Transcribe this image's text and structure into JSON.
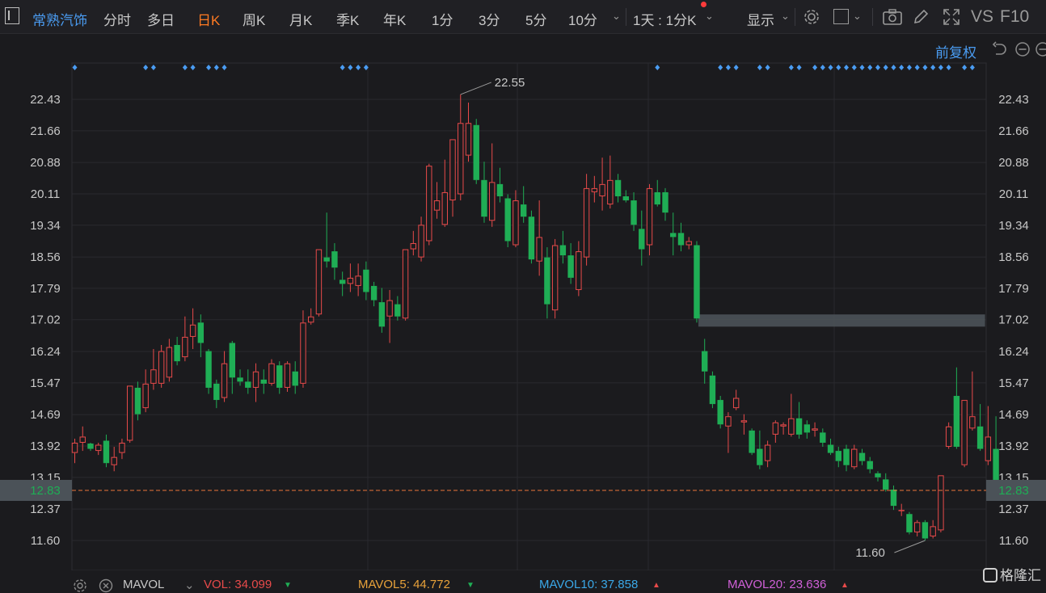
{
  "toolbar": {
    "menu_icon": "menu-icon",
    "stock_name": "常熟汽饰",
    "periods": [
      "分时",
      "多日",
      "日K",
      "周K",
      "月K",
      "季K",
      "年K",
      "1分",
      "3分",
      "5分",
      "10分"
    ],
    "active_period": "日K",
    "interval_select": "1天 : 1分K",
    "display_label": "显示",
    "vs_label": "VS",
    "f10_label": "F10"
  },
  "subbar": {
    "adjust_label": "前复权"
  },
  "colors": {
    "up": "#e84a4a",
    "down": "#1fae55",
    "accent": "#4a9cf2",
    "active": "#ff7a22",
    "last_price_line": "#e8743a"
  },
  "chart_data": {
    "type": "candlestick",
    "y_ticks": [
      22.43,
      21.66,
      20.88,
      20.11,
      19.34,
      18.56,
      17.79,
      17.02,
      16.24,
      15.47,
      14.69,
      13.92,
      13.15,
      12.37,
      11.6
    ],
    "ylim": [
      11.2,
      23.2
    ],
    "last_price": 12.83,
    "high_label": "22.55",
    "low_label": "11.60",
    "grid": true,
    "candles": [
      [
        13.75,
        14.0,
        14.1,
        13.5
      ],
      [
        14.0,
        14.15,
        14.4,
        13.8
      ],
      [
        13.98,
        13.85,
        14.0,
        13.8
      ],
      [
        13.8,
        13.95,
        14.0,
        13.7
      ],
      [
        14.05,
        13.5,
        14.2,
        13.4
      ],
      [
        13.45,
        13.65,
        13.9,
        13.3
      ],
      [
        13.75,
        14.0,
        14.1,
        13.6
      ],
      [
        14.05,
        15.4,
        15.4,
        14.0
      ],
      [
        15.35,
        14.7,
        15.5,
        14.55
      ],
      [
        14.85,
        15.45,
        15.8,
        14.75
      ],
      [
        15.45,
        15.8,
        16.3,
        15.3
      ],
      [
        15.45,
        16.25,
        16.4,
        15.35
      ],
      [
        15.6,
        16.35,
        16.55,
        15.5
      ],
      [
        16.4,
        16.0,
        16.6,
        15.9
      ],
      [
        16.1,
        16.6,
        17.1,
        16.0
      ],
      [
        16.6,
        16.9,
        17.3,
        16.3
      ],
      [
        16.95,
        16.45,
        17.15,
        16.1
      ],
      [
        16.25,
        15.35,
        16.3,
        15.2
      ],
      [
        15.45,
        15.05,
        15.55,
        14.85
      ],
      [
        15.1,
        15.95,
        16.25,
        15.0
      ],
      [
        16.45,
        15.6,
        16.5,
        15.2
      ],
      [
        15.6,
        15.5,
        15.8,
        15.4
      ],
      [
        15.5,
        15.35,
        15.8,
        15.2
      ],
      [
        15.35,
        15.75,
        15.95,
        15.0
      ],
      [
        15.55,
        15.45,
        15.8,
        15.2
      ],
      [
        15.45,
        15.95,
        16.05,
        15.4
      ],
      [
        15.9,
        15.35,
        16.0,
        15.2
      ],
      [
        15.35,
        15.95,
        16.0,
        15.25
      ],
      [
        15.75,
        15.4,
        16.0,
        15.2
      ],
      [
        15.45,
        16.95,
        17.25,
        15.35
      ],
      [
        16.95,
        17.1,
        17.3,
        16.9
      ],
      [
        17.15,
        18.75,
        18.75,
        17.1
      ],
      [
        18.55,
        18.45,
        19.65,
        18.3
      ],
      [
        18.7,
        18.3,
        18.9,
        18.0
      ],
      [
        18.0,
        17.9,
        18.2,
        17.6
      ],
      [
        17.9,
        18.05,
        18.4,
        17.7
      ],
      [
        17.85,
        18.1,
        18.4,
        17.6
      ],
      [
        18.25,
        17.7,
        18.45,
        17.5
      ],
      [
        17.85,
        17.5,
        17.95,
        17.35
      ],
      [
        17.45,
        16.85,
        17.8,
        16.7
      ],
      [
        17.1,
        17.5,
        17.75,
        16.45
      ],
      [
        17.4,
        17.1,
        17.6,
        17.0
      ],
      [
        17.05,
        18.75,
        18.75,
        17.0
      ],
      [
        18.75,
        18.9,
        19.2,
        18.6
      ],
      [
        18.55,
        19.35,
        19.55,
        18.45
      ],
      [
        18.95,
        20.8,
        20.85,
        18.85
      ],
      [
        19.7,
        19.95,
        20.4,
        19.5
      ],
      [
        19.35,
        20.15,
        20.95,
        19.3
      ],
      [
        19.95,
        21.45,
        21.45,
        19.55
      ],
      [
        20.1,
        21.85,
        22.55,
        19.95
      ],
      [
        21.05,
        21.85,
        22.35,
        20.9
      ],
      [
        21.8,
        20.45,
        21.95,
        20.35
      ],
      [
        20.45,
        19.55,
        20.9,
        19.4
      ],
      [
        19.45,
        20.4,
        21.35,
        19.3
      ],
      [
        20.35,
        20.05,
        20.75,
        19.9
      ],
      [
        20.0,
        18.95,
        20.1,
        18.8
      ],
      [
        18.85,
        19.95,
        20.2,
        18.8
      ],
      [
        19.85,
        19.55,
        20.3,
        19.4
      ],
      [
        19.55,
        18.5,
        19.7,
        18.4
      ],
      [
        18.45,
        19.05,
        19.95,
        18.1
      ],
      [
        18.55,
        17.4,
        18.8,
        17.05
      ],
      [
        17.25,
        18.85,
        19.0,
        17.05
      ],
      [
        18.85,
        18.6,
        19.2,
        18.4
      ],
      [
        18.6,
        18.05,
        18.9,
        17.9
      ],
      [
        17.75,
        18.7,
        18.95,
        17.6
      ],
      [
        18.55,
        20.25,
        20.6,
        18.35
      ],
      [
        20.15,
        20.25,
        20.55,
        19.9
      ],
      [
        20.05,
        20.35,
        21.0,
        19.7
      ],
      [
        19.85,
        20.45,
        21.05,
        19.75
      ],
      [
        20.45,
        20.05,
        20.6,
        19.9
      ],
      [
        20.05,
        19.95,
        20.2,
        19.9
      ],
      [
        19.95,
        19.35,
        20.15,
        19.2
      ],
      [
        19.25,
        18.75,
        19.7,
        18.35
      ],
      [
        18.85,
        20.25,
        20.35,
        18.6
      ],
      [
        20.15,
        19.85,
        20.45,
        19.8
      ],
      [
        20.15,
        19.65,
        20.25,
        19.45
      ],
      [
        19.15,
        19.05,
        19.65,
        18.6
      ],
      [
        19.15,
        18.85,
        19.4,
        18.7
      ],
      [
        18.85,
        18.95,
        19.05,
        18.75
      ],
      [
        18.85,
        17.05,
        18.95,
        16.95
      ],
      [
        16.25,
        15.75,
        16.55,
        15.45
      ],
      [
        15.65,
        14.95,
        15.75,
        14.85
      ],
      [
        15.05,
        14.45,
        15.15,
        14.35
      ],
      [
        14.4,
        14.65,
        14.75,
        13.75
      ],
      [
        14.85,
        15.1,
        15.3,
        14.8
      ],
      [
        14.5,
        14.55,
        14.7,
        14.2
      ],
      [
        14.3,
        13.75,
        14.35,
        13.7
      ],
      [
        13.85,
        13.45,
        14.3,
        13.35
      ],
      [
        13.55,
        13.95,
        14.05,
        13.4
      ],
      [
        14.2,
        14.5,
        14.55,
        14.0
      ],
      [
        14.4,
        14.45,
        14.5,
        14.2
      ],
      [
        14.2,
        14.6,
        15.2,
        14.15
      ],
      [
        14.6,
        14.2,
        15.0,
        14.1
      ],
      [
        14.45,
        14.25,
        14.55,
        14.1
      ],
      [
        14.3,
        14.35,
        14.5,
        14.15
      ],
      [
        14.25,
        14.0,
        14.35,
        13.9
      ],
      [
        13.95,
        13.75,
        14.1,
        13.7
      ],
      [
        13.8,
        13.55,
        13.9,
        13.4
      ],
      [
        13.85,
        13.45,
        13.95,
        13.3
      ],
      [
        13.4,
        13.85,
        13.95,
        13.35
      ],
      [
        13.75,
        13.55,
        13.85,
        13.45
      ],
      [
        13.55,
        13.35,
        13.65,
        13.25
      ],
      [
        13.25,
        13.15,
        13.3,
        13.05
      ],
      [
        13.1,
        12.85,
        13.25,
        12.8
      ],
      [
        12.85,
        12.45,
        12.95,
        12.35
      ],
      [
        12.35,
        12.35,
        12.5,
        12.2
      ],
      [
        12.25,
        11.8,
        12.3,
        11.75
      ],
      [
        11.8,
        12.05,
        12.1,
        11.7
      ],
      [
        12.05,
        11.65,
        12.1,
        11.6
      ],
      [
        11.7,
        11.95,
        12.1,
        11.65
      ],
      [
        11.85,
        13.2,
        13.2,
        11.8
      ],
      [
        13.9,
        14.4,
        14.5,
        13.85
      ],
      [
        15.15,
        13.9,
        15.85,
        13.85
      ],
      [
        13.45,
        15.05,
        15.05,
        13.4
      ],
      [
        14.35,
        14.65,
        15.75,
        14.3
      ],
      [
        14.4,
        13.85,
        14.95,
        13.8
      ],
      [
        13.55,
        14.15,
        14.9,
        13.45
      ],
      [
        13.85,
        12.85,
        14.65,
        12.83
      ]
    ],
    "marker_columns": [
      0,
      9,
      10,
      14,
      15,
      17,
      18,
      19,
      34,
      35,
      36,
      37,
      74,
      82,
      83,
      84,
      87,
      88,
      91,
      92,
      94,
      95,
      96,
      97,
      98,
      99,
      100,
      101,
      102,
      103,
      104,
      105,
      106,
      107,
      108,
      109,
      110,
      111,
      113,
      114
    ],
    "zone": {
      "low": 16.85,
      "high": 17.15,
      "from_index": 79,
      "to_index": 115
    }
  },
  "footer": {
    "mavol_label": "MAVOL",
    "vol": "VOL: 34.099",
    "mavol5": "MAVOL5: 44.772",
    "mavol10": "MAVOL10: 37.858",
    "mavol20": "MAVOL20: 23.636"
  },
  "watermark": "格隆汇"
}
